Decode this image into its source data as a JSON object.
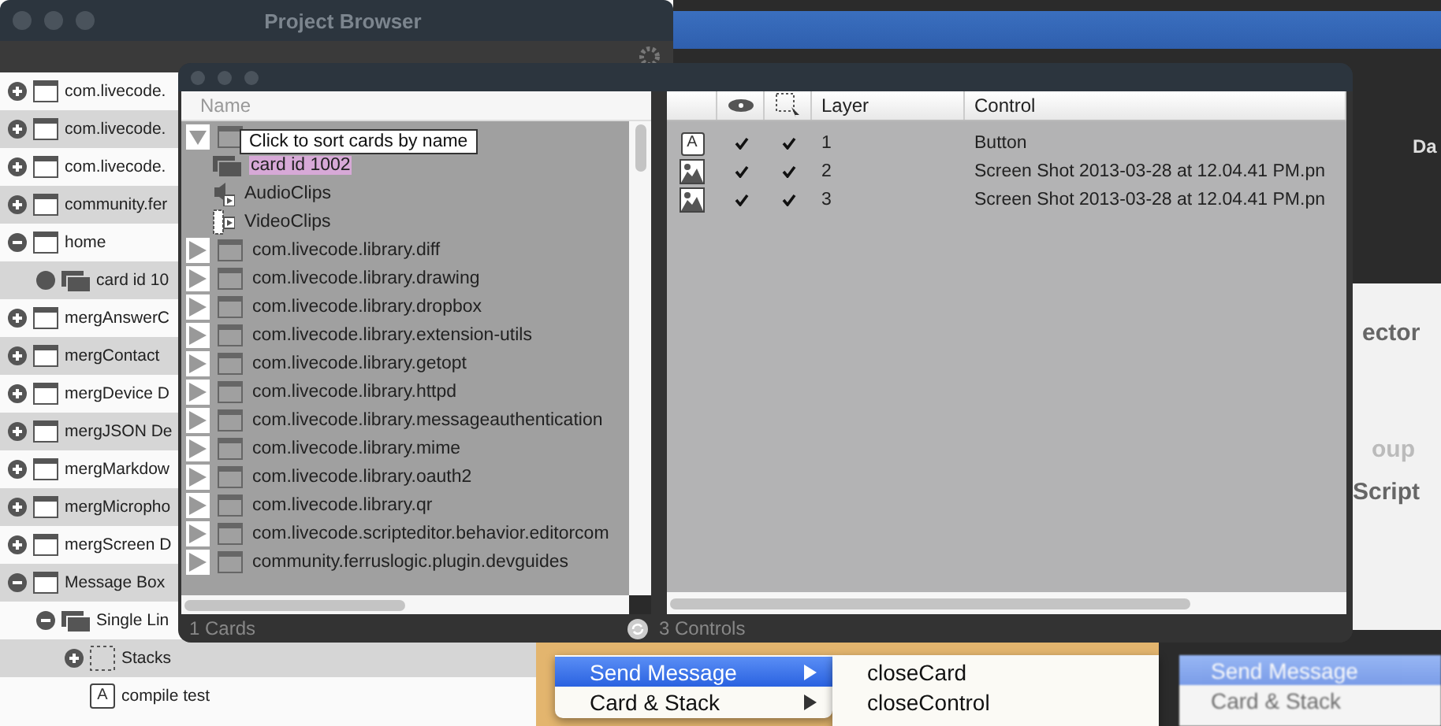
{
  "project_browser": {
    "title": "Project Browser",
    "rows": [
      {
        "kind": "stack",
        "label": "com.livecode.",
        "expanded": false
      },
      {
        "kind": "stack",
        "label": "com.livecode.",
        "expanded": false
      },
      {
        "kind": "stack",
        "label": "com.livecode.",
        "expanded": false
      },
      {
        "kind": "stack",
        "label": "community.fer",
        "expanded": false
      },
      {
        "kind": "stack",
        "label": "home",
        "expanded": true,
        "children": [
          {
            "kind": "card",
            "label": "card id 10"
          }
        ]
      },
      {
        "kind": "stack",
        "label": "mergAnswerC",
        "expanded": false
      },
      {
        "kind": "stack",
        "label": "mergContact",
        "expanded": false
      },
      {
        "kind": "stack",
        "label": "mergDevice D",
        "expanded": false
      },
      {
        "kind": "stack",
        "label": "mergJSON De",
        "expanded": false
      },
      {
        "kind": "stack",
        "label": "mergMarkdow",
        "expanded": false
      },
      {
        "kind": "stack",
        "label": "mergMicropho",
        "expanded": false
      },
      {
        "kind": "stack",
        "label": "mergScreen D",
        "expanded": false
      },
      {
        "kind": "stack",
        "label": "Message Box",
        "expanded": true,
        "children": [
          {
            "kind": "card",
            "label": "Single Lin",
            "expanded": true,
            "children": [
              {
                "kind": "group",
                "label": "Stacks",
                "expanded": false
              },
              {
                "kind": "button",
                "icon": "A",
                "label": "compile test"
              }
            ]
          }
        ]
      }
    ]
  },
  "back_panel": {
    "texts": [
      "Da",
      "ector",
      "oup",
      "Script"
    ],
    "menu": [
      {
        "label": "Send Message",
        "selected": true
      },
      {
        "label": "Card & Stack",
        "selected": false
      }
    ]
  },
  "inspector": {
    "name_header": "Name",
    "tooltip": "Click to sort cards by name",
    "tree": [
      {
        "kind": "stack",
        "expanded": true,
        "selected": false,
        "children": [
          {
            "kind": "card",
            "label": "card id 1002",
            "selected": true
          },
          {
            "kind": "audio",
            "label": "AudioClips",
            "selected": false
          },
          {
            "kind": "video",
            "label": "VideoClips",
            "selected": false
          }
        ]
      },
      {
        "kind": "stack",
        "label": "com.livecode.library.diff",
        "expanded": false,
        "selected": false
      },
      {
        "kind": "stack",
        "label": "com.livecode.library.drawing",
        "expanded": false,
        "selected": false
      },
      {
        "kind": "stack",
        "label": "com.livecode.library.dropbox",
        "expanded": false,
        "selected": false
      },
      {
        "kind": "stack",
        "label": "com.livecode.library.extension-utils",
        "expanded": false,
        "selected": false
      },
      {
        "kind": "stack",
        "label": "com.livecode.library.getopt",
        "expanded": false,
        "selected": false
      },
      {
        "kind": "stack",
        "label": "com.livecode.library.httpd",
        "expanded": false,
        "selected": false
      },
      {
        "kind": "stack",
        "label": "com.livecode.library.messageauthentication",
        "expanded": false,
        "selected": false
      },
      {
        "kind": "stack",
        "label": "com.livecode.library.mime",
        "expanded": false,
        "selected": false
      },
      {
        "kind": "stack",
        "label": "com.livecode.library.oauth2",
        "expanded": false,
        "selected": false
      },
      {
        "kind": "stack",
        "label": "com.livecode.library.qr",
        "expanded": false,
        "selected": false
      },
      {
        "kind": "stack",
        "label": "com.livecode.scripteditor.behavior.editorcom",
        "expanded": false,
        "selected": false
      },
      {
        "kind": "stack",
        "label": "community.ferruslogic.plugin.devguides",
        "expanded": false,
        "selected": false
      }
    ],
    "columns": [
      "Layer",
      "Control"
    ],
    "controls": [
      {
        "kind": "button",
        "icon": "A",
        "visible": true,
        "selectable": true,
        "layer": "1",
        "control": "Button"
      },
      {
        "kind": "image",
        "visible": true,
        "selectable": true,
        "layer": "2",
        "control": "Screen Shot 2013-03-28 at 12.04.41 PM.pn"
      },
      {
        "kind": "image",
        "visible": true,
        "selectable": true,
        "layer": "3",
        "control": "Screen Shot 2013-03-28 at 12.04.41 PM.pn"
      }
    ],
    "cards_count": "1 Cards",
    "controls_count": "3 Controls"
  },
  "context_menu": {
    "items": [
      {
        "label": "Send Message",
        "selected": true,
        "submenu": true
      },
      {
        "label": "Card & Stack",
        "selected": false,
        "submenu": true
      }
    ],
    "submenu": [
      "closeCard",
      "closeControl"
    ]
  }
}
